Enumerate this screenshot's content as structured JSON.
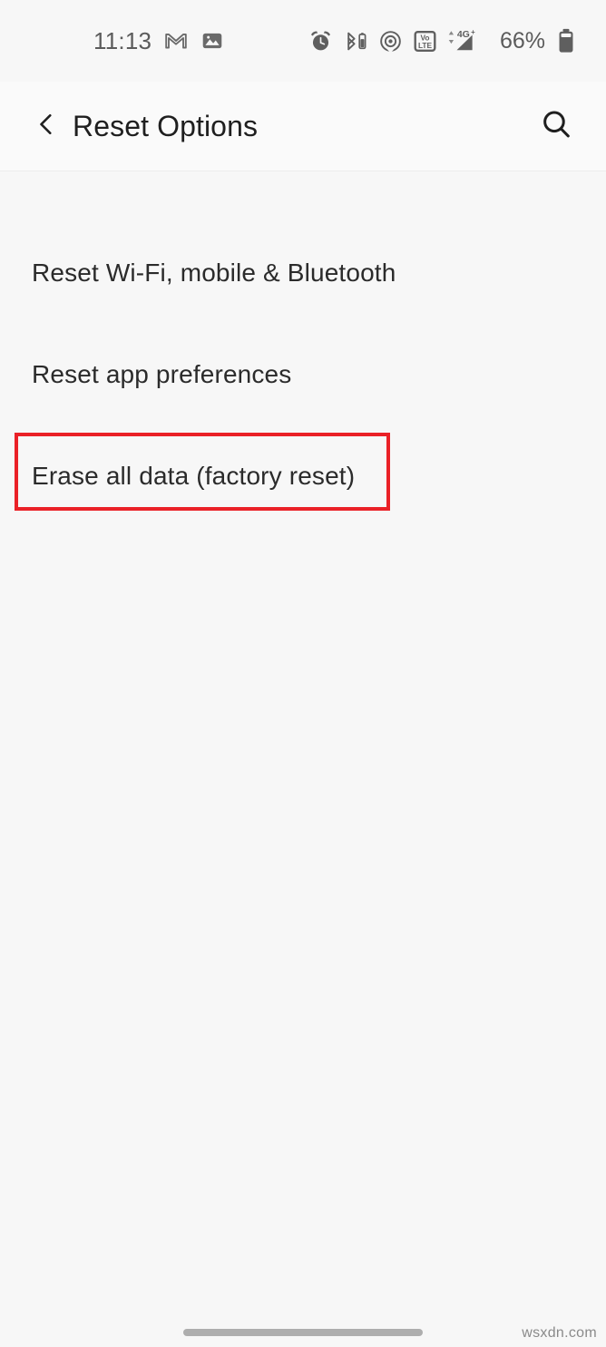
{
  "status_bar": {
    "clock": "11:13",
    "battery_percent": "66%",
    "network_label": "4G+",
    "volte_top": "Vo",
    "volte_bottom": "LTE",
    "left_icons": [
      {
        "name": "gmail-icon",
        "label": "Gmail"
      },
      {
        "name": "gallery-icon",
        "label": "Photos"
      }
    ],
    "right_icons": [
      {
        "name": "alarm-clock-icon",
        "label": "Alarm set"
      },
      {
        "name": "bluetooth-battery-icon",
        "label": "Bluetooth device battery"
      },
      {
        "name": "hotspot-icon",
        "label": "Hotspot"
      },
      {
        "name": "volte-icon",
        "label": "VoLTE"
      },
      {
        "name": "signal-4gplus-icon",
        "label": "4G+ signal"
      },
      {
        "name": "battery-icon",
        "label": "Battery"
      }
    ]
  },
  "app_bar": {
    "title": "Reset Options",
    "back_icon": "chevron-left-icon",
    "search_icon": "search-icon"
  },
  "list": {
    "items": [
      {
        "label": "Reset Wi-Fi, mobile & Bluetooth",
        "highlighted": false
      },
      {
        "label": "Reset app preferences",
        "highlighted": false
      },
      {
        "label": "Erase all data (factory reset)",
        "highlighted": true
      }
    ]
  },
  "annotation": {
    "target": "Erase all data (factory reset)",
    "color": "#ea2127"
  },
  "footer": {
    "watermark": "wsxdn.com"
  },
  "colors": {
    "background": "#f7f7f7",
    "app_bar": "#fafafa",
    "primary_text": "#1f1f1f",
    "list_text": "#2b2b2b",
    "status_text": "#5b5b5b",
    "annotation_red": "#ea2127",
    "home_indicator": "#aeaeae"
  }
}
